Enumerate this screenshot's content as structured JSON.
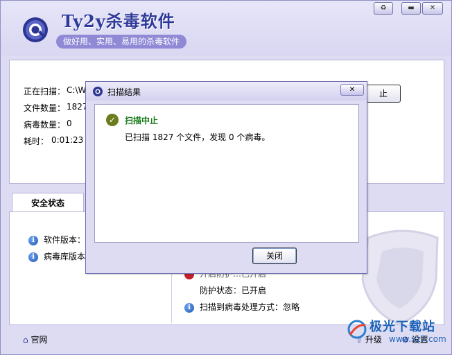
{
  "app": {
    "title": "Ty2y杀毒软件",
    "slogan": "做好用、实用、易用的杀毒软件"
  },
  "scan": {
    "path_label": "正在扫描：",
    "path_value": "C:\\W",
    "files_label": "文件数量：",
    "files_value": "1827",
    "virus_label": "病毒数量：",
    "virus_value": "0",
    "time_label": "耗时：",
    "time_value": "0:01:23",
    "stop_label": "止"
  },
  "tabs": {
    "security": "安全状态"
  },
  "status": {
    "software_version_label": "软件版本：",
    "virus_db_label": "病毒库版本",
    "protection_partial": "开启防护…已开启",
    "protection_state": "防护状态：已开启",
    "handling": "扫描到病毒处理方式：忽略"
  },
  "footer": {
    "home_link": "官网",
    "upgrade": "升级",
    "settings": "设置",
    "watermark_name": "极光下载站",
    "watermark_url": "www.xz7.com"
  },
  "dialog": {
    "title": "扫描结果",
    "heading": "扫描中止",
    "message": "已扫描 1827 个文件，发现 0 个病毒。",
    "close_button": "关闭"
  },
  "colors": {
    "accent": "#2e3a9a",
    "background": "#dedcf3",
    "success": "#1a7a1a"
  }
}
